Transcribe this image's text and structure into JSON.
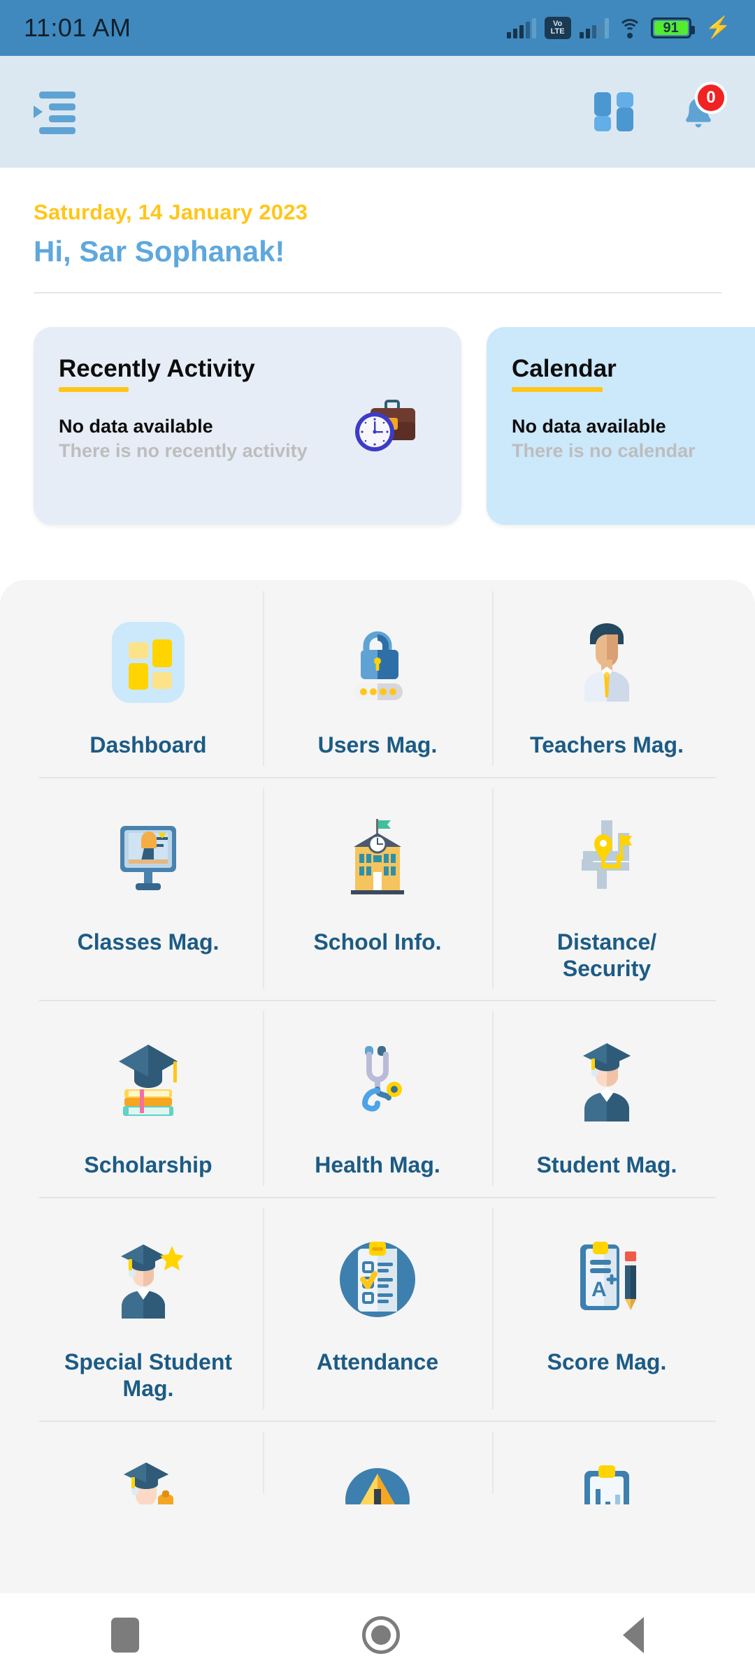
{
  "status_bar": {
    "time": "11:01 AM",
    "volte_top": "Vo",
    "volte_bottom": "LTE",
    "battery_percent": "91",
    "icons": [
      "signal-icon",
      "volte-icon",
      "signal-icon",
      "wifi-icon",
      "battery-icon",
      "charging-bolt-icon"
    ],
    "bar_color": "#4089BF",
    "battery_fill_color": "#54EC2F"
  },
  "app_bar": {
    "menu_icon": "indent-menu-icon",
    "grid_icon": "grid-view-icon",
    "bell_icon": "notification-bell-icon",
    "notification_count": "0",
    "badge_color": "#F02222",
    "background": "#DCE8F1"
  },
  "greeting": {
    "date": "Saturday, 14 January 2023",
    "date_color": "#FFC61A",
    "salutation": "Hi, Sar Sophanak!",
    "salutation_color": "#5EA8DD"
  },
  "cards": [
    {
      "title": "Recently Activity",
      "main_text": "No data available",
      "sub_text": "There is no recently activity",
      "background": "#E6EDF6",
      "underline_color": "#FFC61A",
      "illustration": "briefcase-clock-icon"
    },
    {
      "title": "Calendar",
      "main_text": "No data available",
      "sub_text": "There is no calendar",
      "background": "#CCE8FB",
      "underline_color": "#FFC61A",
      "illustration": "none"
    }
  ],
  "menu": {
    "label_color": "#1C5B85",
    "panel_background": "#F5F5F5",
    "rows": [
      [
        {
          "label": "Dashboard",
          "icon": "dashboard-tiles-icon"
        },
        {
          "label": "Users Mag.",
          "icon": "padlock-password-icon"
        },
        {
          "label": "Teachers Mag.",
          "icon": "teacher-avatar-icon"
        }
      ],
      [
        {
          "label": "Classes Mag.",
          "icon": "monitor-classroom-icon"
        },
        {
          "label": "School Info.",
          "icon": "school-building-icon"
        },
        {
          "label": "Distance/\nSecurity",
          "icon": "map-route-pin-icon"
        }
      ],
      [
        {
          "label": "Scholarship",
          "icon": "graduation-cap-books-icon"
        },
        {
          "label": "Health Mag.",
          "icon": "stethoscope-icon"
        },
        {
          "label": "Student Mag.",
          "icon": "student-graduate-icon"
        }
      ],
      [
        {
          "label": "Special Student\nMag.",
          "icon": "star-graduate-icon"
        },
        {
          "label": "Attendance",
          "icon": "clipboard-checklist-icon"
        },
        {
          "label": "Score Mag.",
          "icon": "report-card-pencil-icon"
        }
      ]
    ],
    "partial_row": [
      {
        "label": "",
        "icon": "graduate-cap-icon"
      },
      {
        "label": "",
        "icon": "warning-triangle-icon"
      },
      {
        "label": "",
        "icon": "clipboard-chart-icon"
      }
    ]
  },
  "nav_bar": {
    "recents": "recents-square-button",
    "home": "home-circle-button",
    "back": "back-triangle-button",
    "color": "#7C7C7C"
  }
}
